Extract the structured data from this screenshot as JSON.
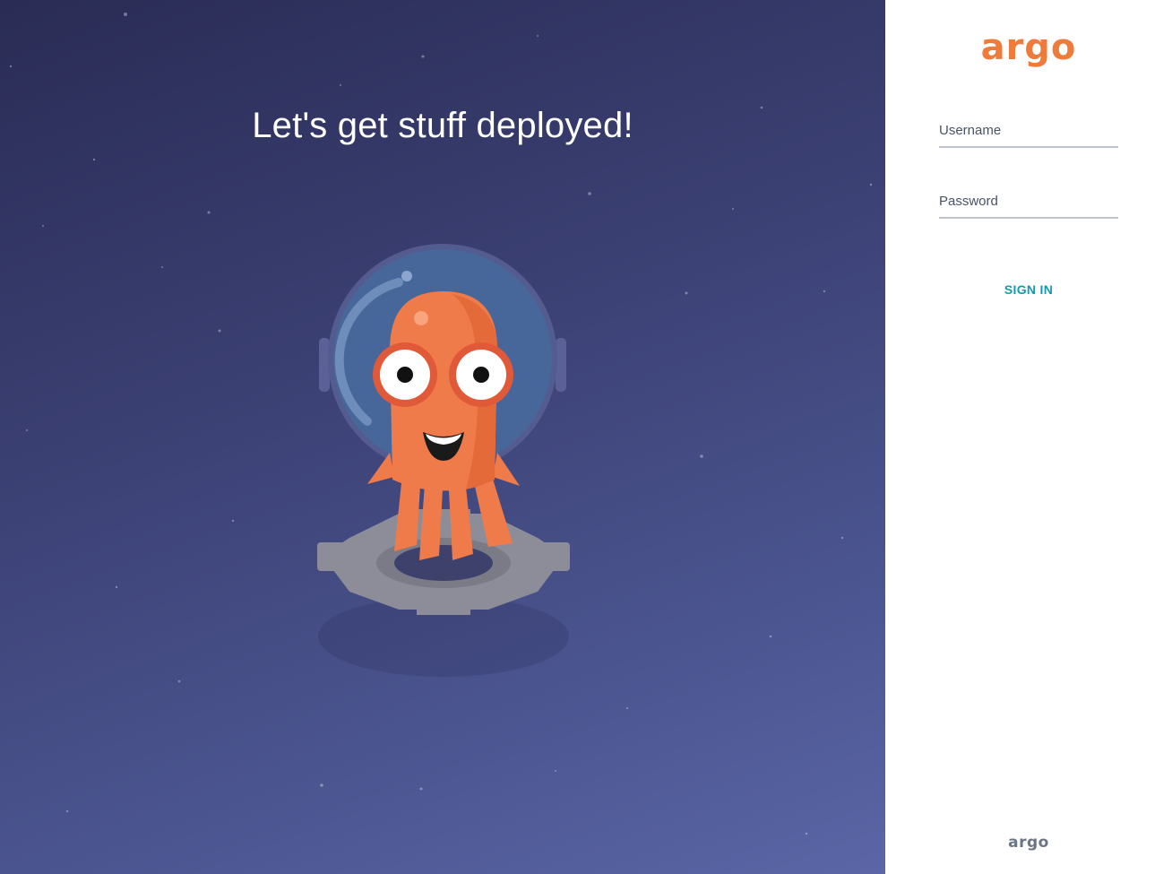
{
  "hero": {
    "headline": "Let's get stuff deployed!",
    "mascot_icon": "argo-octopus-astronaut-mascot"
  },
  "login": {
    "logo_text": "argo",
    "username": {
      "placeholder": "Username",
      "value": ""
    },
    "password": {
      "placeholder": "Password",
      "value": ""
    },
    "sign_in_label": "SIGN IN"
  },
  "footer": {
    "logo_text": "argo"
  },
  "colors": {
    "brand_orange": "#ef7b3b",
    "sign_in_teal": "#139bad",
    "background_navy": "#3b4073"
  }
}
